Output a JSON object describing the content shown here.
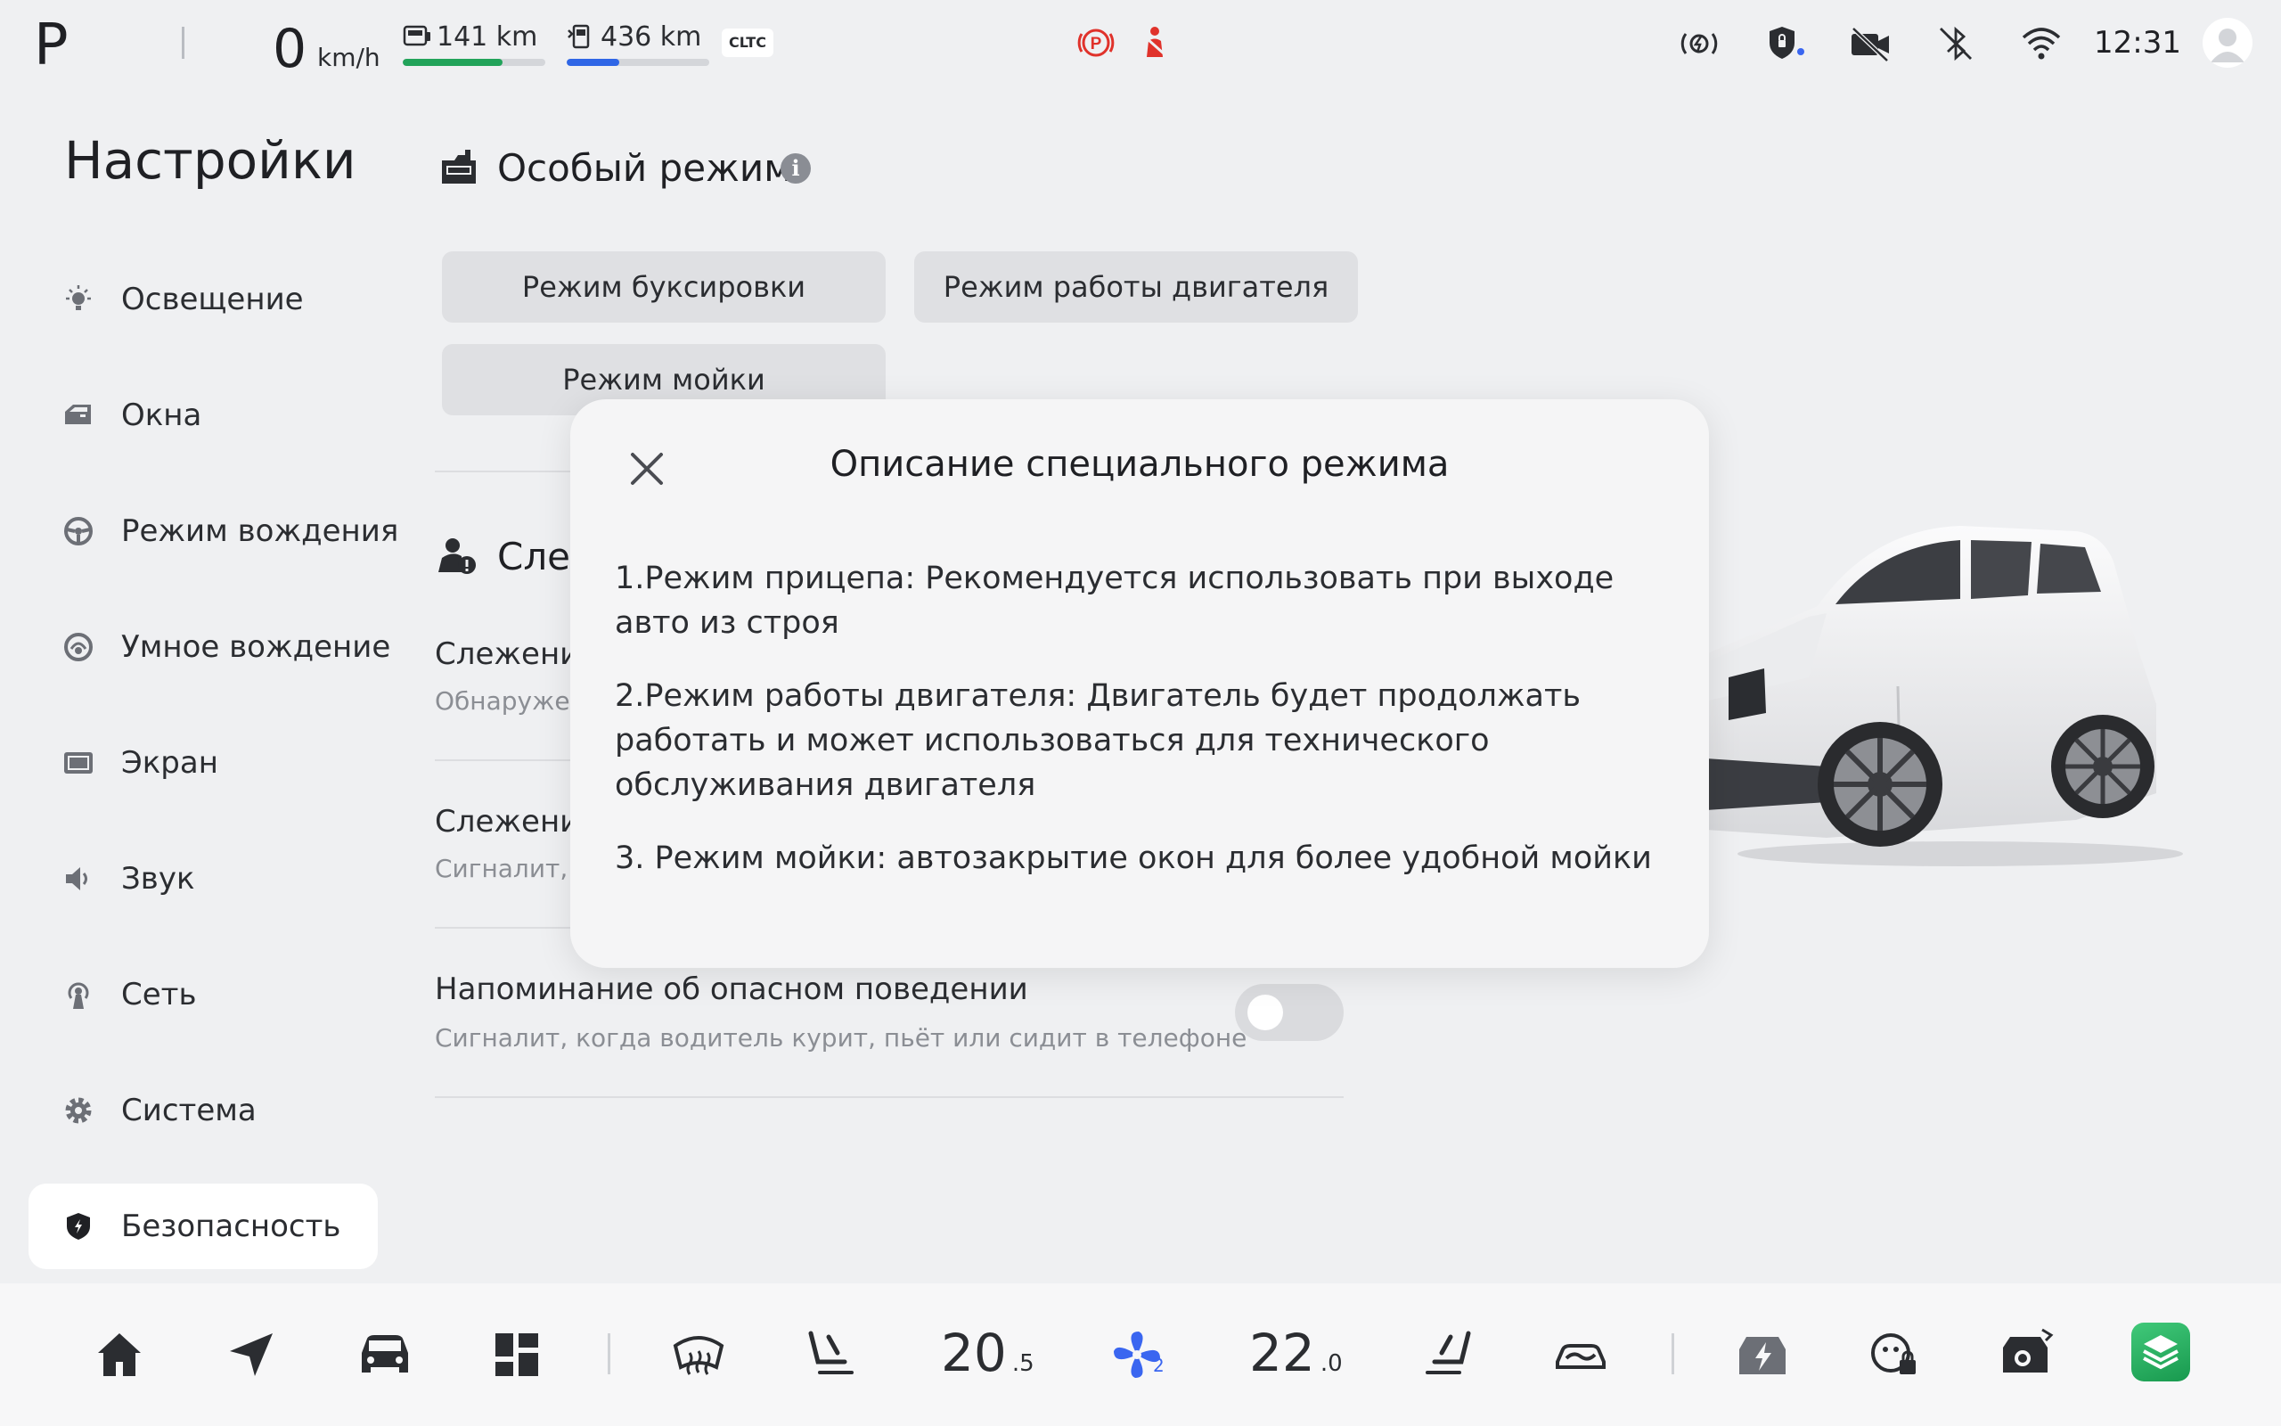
{
  "status_bar": {
    "gear": "P",
    "speed": "0",
    "speed_unit": "km/h",
    "electric_range": "141 km",
    "electric_range_fill": 0.7,
    "fuel_range": "436 km",
    "fuel_range_fill": 0.37,
    "range_standard": "CLTC",
    "time": "12:31",
    "colors": {
      "electric_bar": "#22a35a",
      "fuel_bar": "#2f66e6",
      "warning": "#e0322b"
    }
  },
  "sidebar": {
    "title": "Настройки",
    "items": [
      {
        "label": "Освещение",
        "icon": "lightbulb-icon"
      },
      {
        "label": "Окна",
        "icon": "window-icon"
      },
      {
        "label": "Режим вождения",
        "icon": "steering-wheel-icon"
      },
      {
        "label": "Умное вождение",
        "icon": "smart-drive-icon"
      },
      {
        "label": "Экран",
        "icon": "screen-icon"
      },
      {
        "label": "Звук",
        "icon": "speaker-icon"
      },
      {
        "label": "Сеть",
        "icon": "network-icon"
      },
      {
        "label": "Система",
        "icon": "gear-icon"
      },
      {
        "label": "Безопасность",
        "icon": "shield-icon",
        "active": true
      }
    ]
  },
  "main": {
    "special_mode": {
      "title": "Особый режим",
      "buttons": {
        "tow": "Режим буксировки",
        "engine": "Режим работы двигателя",
        "wash": "Режим мойки"
      }
    },
    "monitoring": {
      "title_partial": "Слеж",
      "rows": [
        {
          "title": "Слежение",
          "subtitle": "Обнаружен"
        },
        {
          "title": "Слежение",
          "subtitle": "Сигналит, к"
        },
        {
          "title": "Напоминание об опасном поведении",
          "subtitle": "Сигналит, когда водитель курит, пьёт или сидит в телефоне",
          "toggle_on": false
        }
      ]
    }
  },
  "modal": {
    "title": "Описание специального режима",
    "paragraphs": [
      "1.Режим прицепа: Рекомендуется использовать при выходе авто из строя",
      "2.Режим работы двигателя: Двигатель будет продолжать работать и может использоваться для технического обслуживания двигателя",
      "3. Режим мойки: автозакрытие окон для более удобной мойки"
    ]
  },
  "dock": {
    "temp_left": "20",
    "temp_left_dec": ".5",
    "temp_right": "22",
    "temp_right_dec": ".0",
    "fan_level": "2"
  }
}
